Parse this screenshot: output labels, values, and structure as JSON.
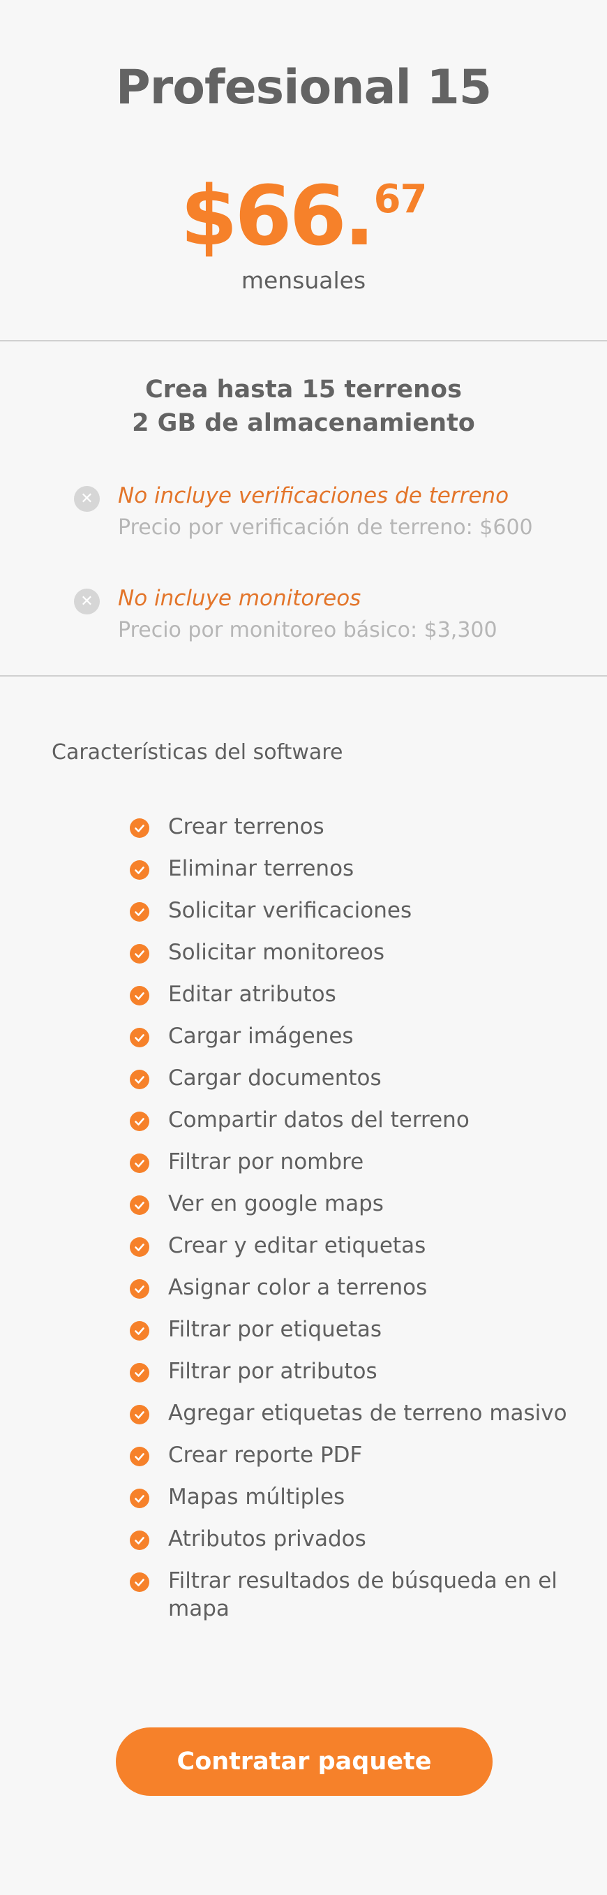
{
  "plan": {
    "title": "Profesional 15",
    "price_main": "$66.",
    "price_cents": "67",
    "price_period": "mensuales"
  },
  "summary": {
    "terrenos": "Crea hasta 15 terrenos",
    "storage": "2 GB de almacenamiento"
  },
  "exclusions": [
    {
      "icon": "x-circle-icon",
      "title": "No incluye verificaciones de terreno",
      "detail": "Precio por verificación de terreno: $600"
    },
    {
      "icon": "x-circle-icon",
      "title": "No incluye monitoreos",
      "detail": "Precio por monitoreo básico: $3,300"
    }
  ],
  "features": {
    "heading": "Características del software",
    "icon": "check-circle-icon",
    "items": [
      "Crear terrenos",
      "Eliminar terrenos",
      "Solicitar verificaciones",
      "Solicitar monitoreos",
      "Editar atributos",
      "Cargar imágenes",
      "Cargar documentos",
      "Compartir datos del terreno",
      "Filtrar por nombre",
      "Ver en google maps",
      "Crear y editar etiquetas",
      "Asignar color a terrenos",
      "Filtrar por etiquetas",
      "Filtrar por atributos",
      "Agregar etiquetas de terreno masivo",
      "Crear reporte PDF",
      "Mapas múltiples",
      "Atributos privados",
      "Filtrar resultados de búsqueda en el mapa"
    ]
  },
  "cta": {
    "label": "Contratar paquete"
  },
  "colors": {
    "accent": "#f6812a",
    "exclusion_title": "#e3752a",
    "text": "#636363",
    "muted": "#b6b6b6",
    "background": "#f7f7f7",
    "divider": "#d0d0d0"
  }
}
